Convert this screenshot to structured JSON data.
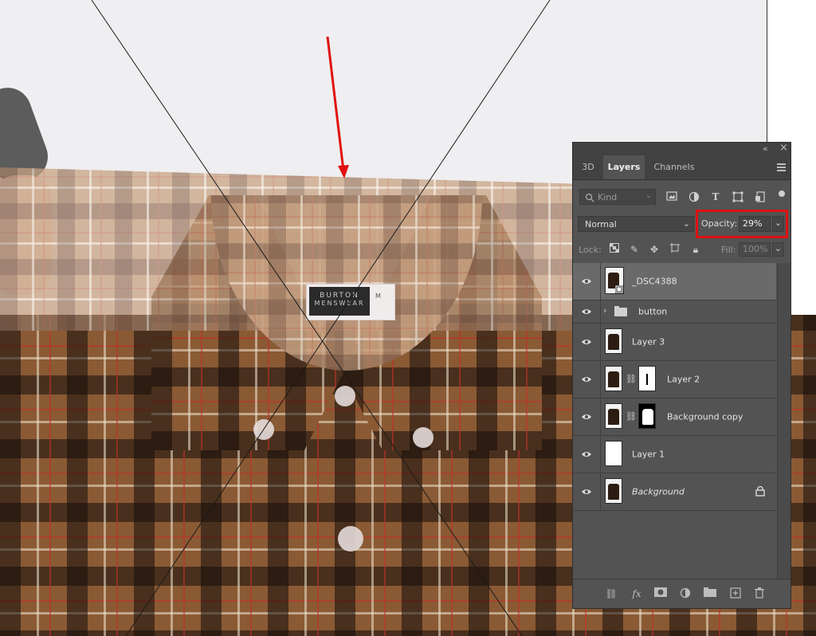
{
  "panel": {
    "collapse_icon": "«",
    "close_icon": "×",
    "tabs": [
      {
        "label": "3D"
      },
      {
        "label": "Layers"
      },
      {
        "label": "Channels"
      }
    ],
    "menu_icon": "panel-menu-icon",
    "filter": {
      "placeholder": "Kind"
    },
    "blend_mode": "Normal",
    "opacity_label": "Opacity:",
    "opacity_value": "29%",
    "opacity_percent": 29,
    "lock_label": "Lock:",
    "fill_label": "Fill:",
    "fill_value": "100%",
    "layers": [
      {
        "name": "_DSC4388",
        "selected": true
      },
      {
        "name": "button",
        "type": "group"
      },
      {
        "name": "Layer 3"
      },
      {
        "name": "Layer 2"
      },
      {
        "name": "Background copy"
      },
      {
        "name": "Layer 1"
      },
      {
        "name": "Background",
        "locked": true
      }
    ]
  },
  "canvas": {
    "label_text_1": "BURTON",
    "label_text_2": "MENSWEAR",
    "label_size": "M",
    "annotation_arrow_color": "#e01010"
  },
  "colors": {
    "highlight": "#e01010",
    "panel_bg": "#535353",
    "selected_row": "#6a6a6a"
  }
}
